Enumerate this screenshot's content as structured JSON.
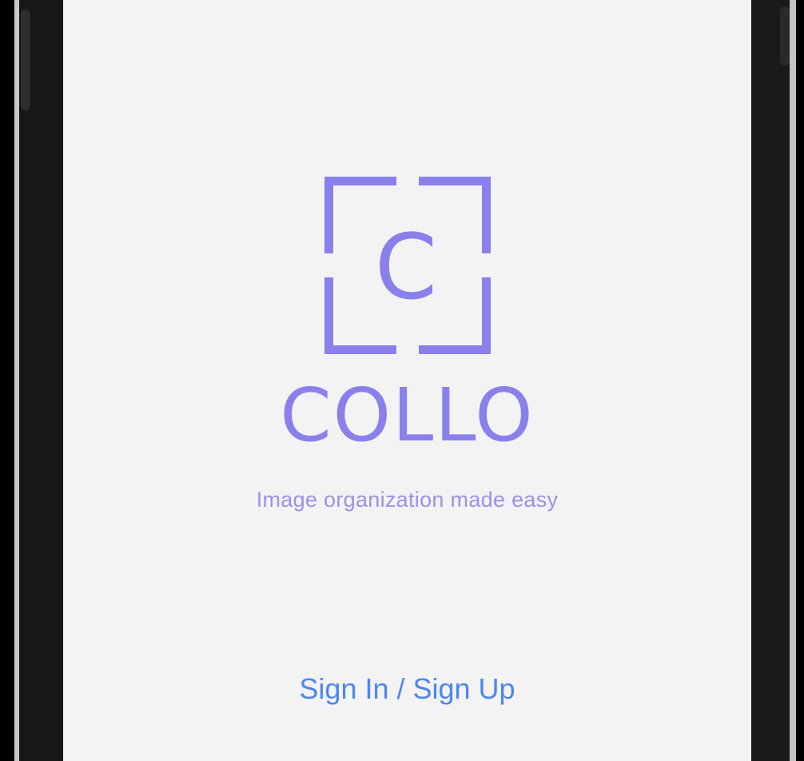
{
  "app": {
    "logo_letter": "C",
    "name": "COLLO",
    "tagline": "Image organization made easy"
  },
  "actions": {
    "sign_in_label": "Sign In / Sign Up"
  },
  "colors": {
    "brand": "#8a80ec",
    "link": "#4d86ef",
    "background": "#f3f3f4",
    "device_frame": "#171717"
  },
  "icons": {
    "logo": "bracket-frame-c-logo-icon"
  }
}
